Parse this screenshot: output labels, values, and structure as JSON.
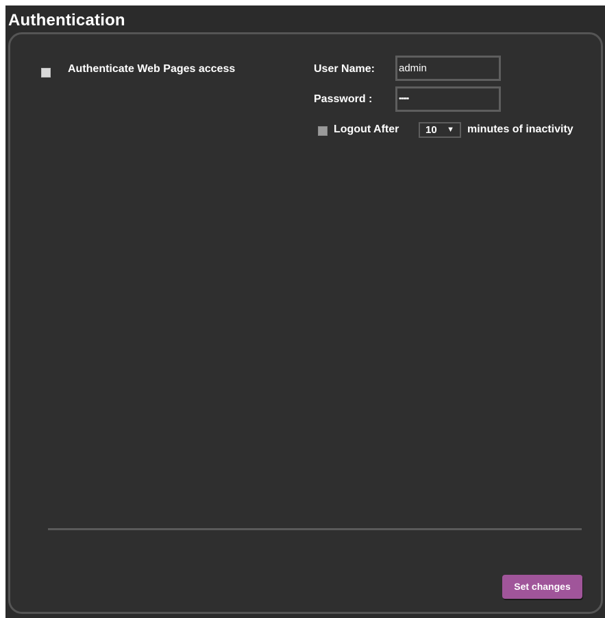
{
  "section": {
    "title": "Authentication"
  },
  "auth": {
    "enable_label": "Authenticate Web Pages access",
    "enable_checked": false,
    "username_label": "User Name:",
    "username_value": "admin",
    "password_label": "Password :",
    "password_mask": "•••••",
    "logout_checkbox_checked": false,
    "logout_label": "Logout After",
    "logout_minutes": "10",
    "logout_suffix": "minutes of inactivity",
    "dropdown_arrow": "▼"
  },
  "actions": {
    "set_changes_label": "Set changes"
  },
  "colors": {
    "background": "#2f2f2f",
    "panel_border": "#555555",
    "button": "#a0559a",
    "text": "#ffffff"
  }
}
